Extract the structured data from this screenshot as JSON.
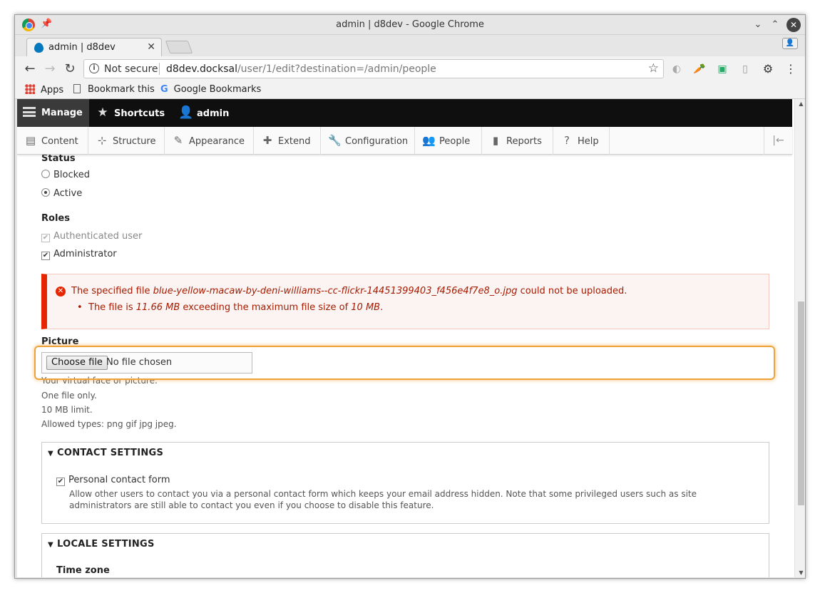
{
  "window": {
    "title": "admin | d8dev - Google Chrome"
  },
  "tab": {
    "title": "admin | d8dev"
  },
  "address_bar": {
    "security": "Not secure",
    "host": "d8dev.docksal",
    "path": "/user/1/edit?destination=/admin/people"
  },
  "bookmarks": {
    "apps": "Apps",
    "bookmark_this": "Bookmark this",
    "google_bookmarks": "Google Bookmarks"
  },
  "admin_toolbar": {
    "manage": "Manage",
    "shortcuts": "Shortcuts",
    "user": "admin"
  },
  "tray": {
    "items": [
      "Content",
      "Structure",
      "Appearance",
      "Extend",
      "Configuration",
      "People",
      "Reports",
      "Help"
    ]
  },
  "form": {
    "status_label": "Status",
    "status_options": [
      "Blocked",
      "Active"
    ],
    "status_selected": "Active",
    "roles_label": "Roles",
    "roles": [
      "Authenticated user",
      "Administrator"
    ],
    "error": {
      "prefix": "The specified file ",
      "filename": "blue-yellow-macaw-by-deni-williams--cc-flickr-14451399403_f456e4f7e8_o.jpg",
      "suffix": " could not be uploaded.",
      "bullet_prefix": "The file is ",
      "size": "11.66 MB",
      "bullet_middle": " exceeding the maximum file size of ",
      "limit": "10 MB",
      "bullet_suffix": "."
    },
    "picture_label": "Picture",
    "file_button": "Choose file",
    "file_status": "No file chosen",
    "picture_help": [
      "Your virtual face or picture.",
      "One file only.",
      "10 MB limit.",
      "Allowed types: png gif jpg jpeg."
    ],
    "contact": {
      "legend": "CONTACT SETTINGS",
      "checkbox_label": "Personal contact form",
      "description": "Allow other users to contact you via a personal contact form which keeps your email address hidden. Note that some privileged users such as site administrators are still able to contact you even if you choose to disable this feature."
    },
    "locale": {
      "legend": "LOCALE SETTINGS",
      "timezone_label": "Time zone"
    }
  }
}
